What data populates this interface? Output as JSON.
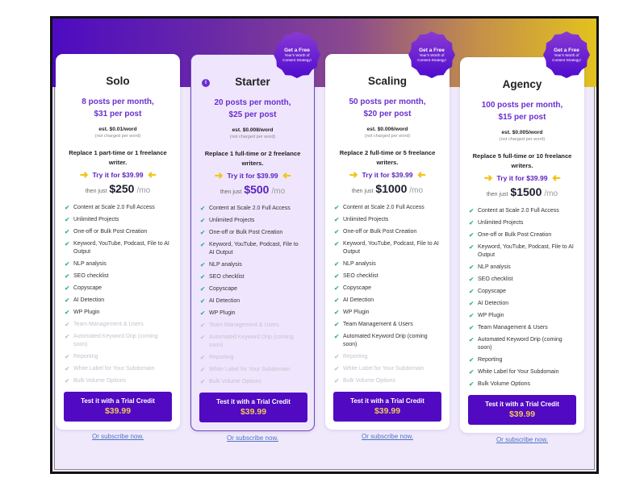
{
  "badge": {
    "title": "Get a Free",
    "line1": "Year's Worth of",
    "line2": "Content Strategy!"
  },
  "common": {
    "try_label": "Try it for $39.99",
    "then_just": "then just",
    "per_month": "/mo",
    "est_note": "(not charged per word)",
    "cta_label": "Test it with a Trial Credit",
    "cta_price": "$39.99",
    "subscribe_link": "Or subscribe now."
  },
  "colors": {
    "accent": "#5109c2",
    "plan_text": "#6a2fd0",
    "check": "#3cb49a",
    "arrow": "#f2c515",
    "cta_price": "#f3c65a",
    "link": "#4f72c4"
  },
  "plans": [
    {
      "name": "Solo",
      "posts_line1": "8 posts per month,",
      "posts_line2": "$31 per post",
      "est": "est. $0.01/word",
      "replace": "Replace 1 part-time or 1 freelance writer.",
      "price": "$250",
      "featured": false,
      "badge": false,
      "features": [
        {
          "label": "Content at Scale 2.0 Full Access",
          "included": true
        },
        {
          "label": "Unlimited Projects",
          "included": true
        },
        {
          "label": "One-off or Bulk Post Creation",
          "included": true
        },
        {
          "label": "Keyword, YouTube, Podcast, File to AI Output",
          "included": true
        },
        {
          "label": "NLP analysis",
          "included": true
        },
        {
          "label": "SEO checklist",
          "included": true
        },
        {
          "label": "Copyscape",
          "included": true
        },
        {
          "label": "AI Detection",
          "included": true
        },
        {
          "label": "WP Plugin",
          "included": true
        },
        {
          "label": "Team Management & Users",
          "included": false
        },
        {
          "label": "Automated Keyword Drip (coming soon)",
          "included": false
        },
        {
          "label": "Reporting",
          "included": false
        },
        {
          "label": "White Label for Your Subdomain",
          "included": false
        },
        {
          "label": "Bulk Volume Options",
          "included": false
        }
      ]
    },
    {
      "name": "Starter",
      "posts_line1": "20 posts per month,",
      "posts_line2": "$25 per post",
      "est": "est. $0.008/word",
      "replace": "Replace 1 full-time or 2 freelance writers.",
      "price": "$500",
      "featured": true,
      "badge": true,
      "features": [
        {
          "label": "Content at Scale 2.0 Full Access",
          "included": true
        },
        {
          "label": "Unlimited Projects",
          "included": true
        },
        {
          "label": "One-off or Bulk Post Creation",
          "included": true
        },
        {
          "label": "Keyword, YouTube, Podcast, File to AI Output",
          "included": true
        },
        {
          "label": "NLP analysis",
          "included": true
        },
        {
          "label": "SEO checklist",
          "included": true
        },
        {
          "label": "Copyscape",
          "included": true
        },
        {
          "label": "AI Detection",
          "included": true
        },
        {
          "label": "WP Plugin",
          "included": true
        },
        {
          "label": "Team Management & Users",
          "included": false
        },
        {
          "label": "Automated Keyword Drip (coming soon)",
          "included": false
        },
        {
          "label": "Reporting",
          "included": false
        },
        {
          "label": "White Label for Your Subdomain",
          "included": false
        },
        {
          "label": "Bulk Volume Options",
          "included": false
        }
      ]
    },
    {
      "name": "Scaling",
      "posts_line1": "50 posts per month,",
      "posts_line2": "$20 per post",
      "est": "est. $0.006/word",
      "replace": "Replace 2 full-time or 5 freelance writers.",
      "price": "$1000",
      "featured": false,
      "badge": true,
      "features": [
        {
          "label": "Content at Scale 2.0 Full Access",
          "included": true
        },
        {
          "label": "Unlimited Projects",
          "included": true
        },
        {
          "label": "One-off or Bulk Post Creation",
          "included": true
        },
        {
          "label": "Keyword, YouTube, Podcast, File to AI Output",
          "included": true
        },
        {
          "label": "NLP analysis",
          "included": true
        },
        {
          "label": "SEO checklist",
          "included": true
        },
        {
          "label": "Copyscape",
          "included": true
        },
        {
          "label": "AI Detection",
          "included": true
        },
        {
          "label": "WP Plugin",
          "included": true
        },
        {
          "label": "Team Management & Users",
          "included": true
        },
        {
          "label": "Automated Keyword Drip (coming soon)",
          "included": true
        },
        {
          "label": "Reporting",
          "included": false
        },
        {
          "label": "White Label for Your Subdomain",
          "included": false
        },
        {
          "label": "Bulk Volume Options",
          "included": false
        }
      ]
    },
    {
      "name": "Agency",
      "posts_line1": "100 posts per month,",
      "posts_line2": "$15 per post",
      "est": "est. $0.005/word",
      "replace": "Replace 5 full-time or 10 freelance writers.",
      "price": "$1500",
      "featured": false,
      "badge": true,
      "features": [
        {
          "label": "Content at Scale 2.0 Full Access",
          "included": true
        },
        {
          "label": "Unlimited Projects",
          "included": true
        },
        {
          "label": "One-off or Bulk Post Creation",
          "included": true
        },
        {
          "label": "Keyword, YouTube, Podcast, File to AI Output",
          "included": true
        },
        {
          "label": "NLP analysis",
          "included": true
        },
        {
          "label": "SEO checklist",
          "included": true
        },
        {
          "label": "Copyscape",
          "included": true
        },
        {
          "label": "AI Detection",
          "included": true
        },
        {
          "label": "WP Plugin",
          "included": true
        },
        {
          "label": "Team Management & Users",
          "included": true
        },
        {
          "label": "Automated Keyword Drip (coming soon)",
          "included": true
        },
        {
          "label": "Reporting",
          "included": true
        },
        {
          "label": "White Label for Your Subdomain",
          "included": true
        },
        {
          "label": "Bulk Volume Options",
          "included": true
        }
      ]
    }
  ]
}
